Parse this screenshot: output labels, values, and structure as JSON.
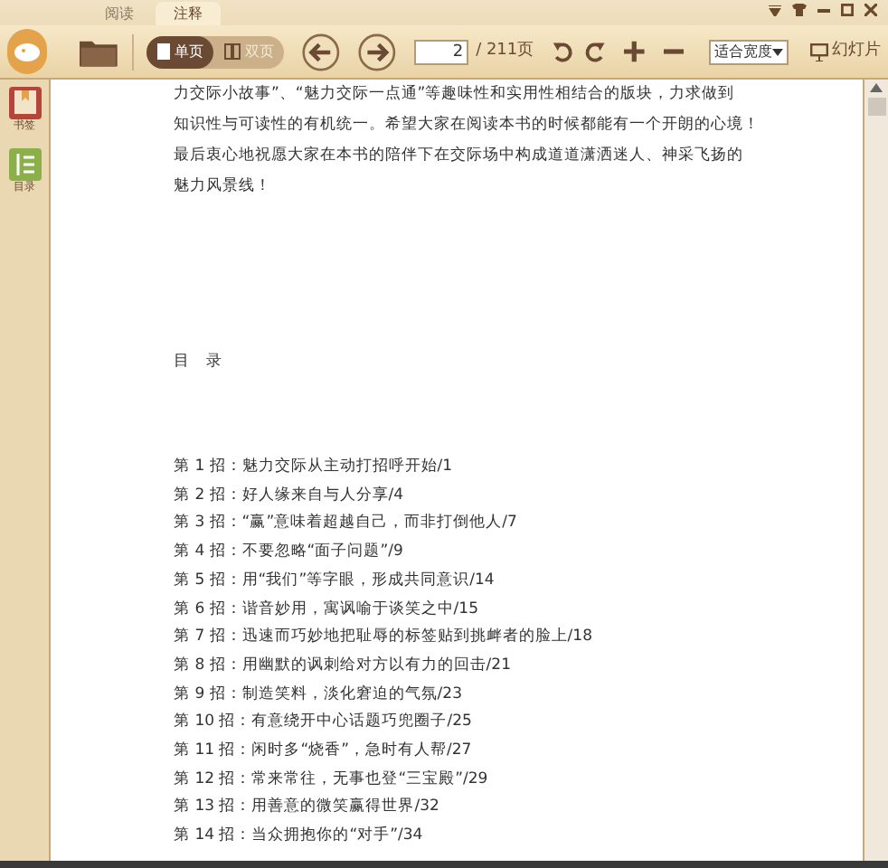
{
  "tabs": [
    {
      "label": "阅读",
      "selected": false
    },
    {
      "label": "注释",
      "selected": true
    }
  ],
  "toolbar": {
    "view_modes": [
      {
        "label": "单页",
        "selected": true
      },
      {
        "label": "双页",
        "selected": false
      }
    ],
    "page_input": "2",
    "page_total": "/ 211页",
    "zoom_select": "适合宽度",
    "slideshow": "幻灯片"
  },
  "sidebar": {
    "items": [
      {
        "label": "书签"
      },
      {
        "label": "目录"
      }
    ]
  },
  "document": {
    "paragraph_lines": [
      "力交际小故事”、“魅力交际一点通”等趣味性和实用性相结合的版块，力求做到",
      "知识性与可读性的有机统一。希望大家在阅读本书的时候都能有一个开朗的心境！",
      "最后衷心地祝愿大家在本书的陪伴下在交际场中构成道道潇洒迷人、神采飞扬的",
      "魅力风景线！"
    ],
    "toc_heading": "目　录",
    "toc": [
      "第 1 招：魅力交际从主动打招呼开始/1",
      "第 2 招：好人缘来自与人分享/4",
      "第 3 招：“赢”意味着超越自己，而非打倒他人/7",
      "第 4 招：不要忽略“面子问题”/9",
      "第 5 招：用“我们”等字眼，形成共同意识/14",
      "第 6 招：谐音妙用，寓讽喻于谈笑之中/15",
      "第 7 招：迅速而巧妙地把耻辱的标签贴到挑衅者的脸上/18",
      "第 8 招：用幽默的讽刺给对方以有力的回击/21",
      "第 9 招：制造笑料，淡化窘迫的气氛/23",
      "第 10 招：有意绕开中心话题巧兜圈子/25",
      "第 11 招：闲时多“烧香”，急时有人帮/27",
      "第 12 招：常来常往，无事也登“三宝殿”/29",
      "第 13 招：用善意的微笑赢得世界/32",
      "第 14 招：当众拥抱你的“对手”/34"
    ]
  }
}
